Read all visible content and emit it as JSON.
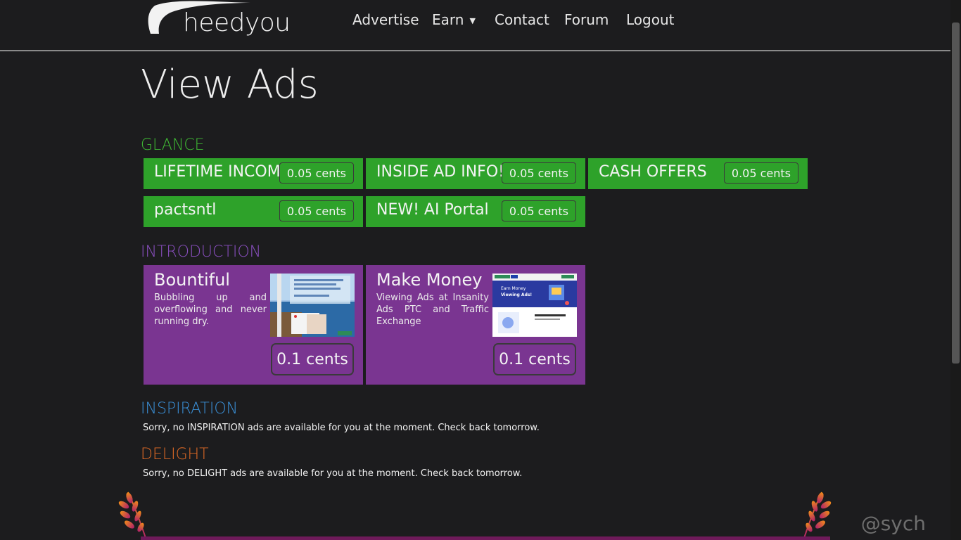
{
  "header": {
    "logo_text": "heedyou",
    "nav": [
      {
        "label": "Advertise"
      },
      {
        "label": "Earn",
        "has_dropdown": true
      },
      {
        "label": "Contact"
      },
      {
        "label": "Forum"
      },
      {
        "label": "Logout"
      }
    ]
  },
  "page_title": "View Ads",
  "sections": {
    "glance": {
      "title": "GLANCE",
      "color": "#3fb934",
      "ads": [
        {
          "name": "LIFETIME INCOME",
          "reward": "0.05 cents"
        },
        {
          "name": "INSIDE AD INFO!",
          "reward": "0.05 cents"
        },
        {
          "name": "CASH OFFERS",
          "reward": "0.05 cents"
        },
        {
          "name": "pactsntl",
          "reward": "0.05 cents"
        },
        {
          "name": "NEW! AI Portal",
          "reward": "0.05 cents"
        }
      ]
    },
    "introduction": {
      "title": "INTRODUCTION",
      "color": "#8a4fc0",
      "ads": [
        {
          "name": "Bountiful",
          "description": "Bubbling up and overflowing and never running dry.",
          "reward": "0.1 cents"
        },
        {
          "name": "Make Money",
          "description": "Viewing Ads at Insanity Ads PTC and Traffic Exchange",
          "reward": "0.1 cents",
          "thumb_text": [
            "Earn Money",
            "Viewing Ads!"
          ]
        }
      ]
    },
    "inspiration": {
      "title": "INSPIRATION",
      "color": "#3a8fd6",
      "message": "Sorry, no INSPIRATION ads are available for you at the moment. Check back tomorrow."
    },
    "delight": {
      "title": "DELIGHT",
      "color": "#e06a25",
      "message": "Sorry, no DELIGHT ads are available for you at the moment. Check back tomorrow."
    }
  },
  "watermark": "@sych"
}
